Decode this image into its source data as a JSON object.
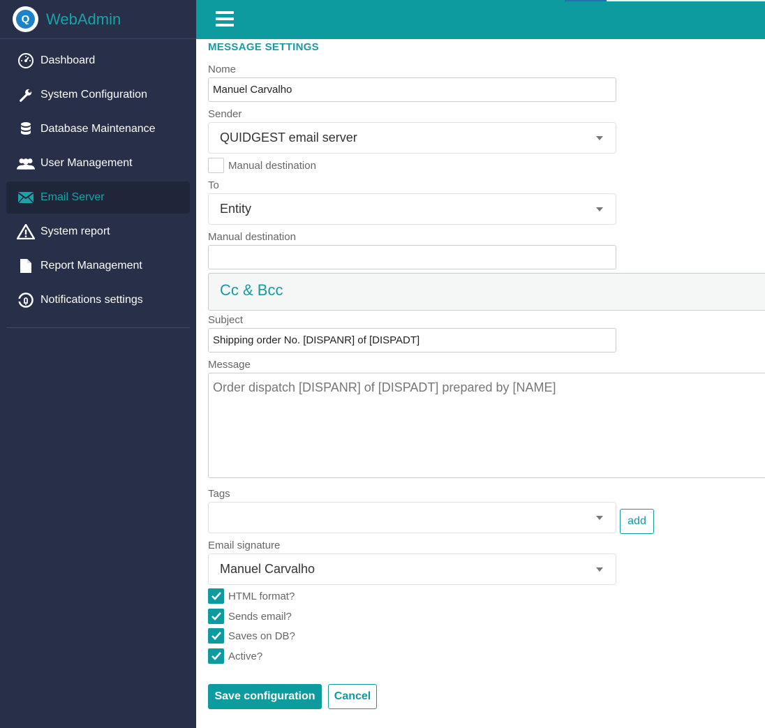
{
  "app": {
    "name": "WebAdmin",
    "logo_letter": "Q"
  },
  "sidebar": {
    "items": [
      {
        "label": "Dashboard",
        "icon": "dashboard-icon"
      },
      {
        "label": "System Configuration",
        "icon": "wrench-icon"
      },
      {
        "label": "Database Maintenance",
        "icon": "database-icon"
      },
      {
        "label": "User Management",
        "icon": "users-icon"
      },
      {
        "label": "Email Server",
        "icon": "envelope-icon",
        "active": true
      },
      {
        "label": "System report",
        "icon": "warning-icon"
      },
      {
        "label": "Report Management",
        "icon": "file-icon"
      },
      {
        "label": "Notifications settings",
        "icon": "notification-icon"
      }
    ]
  },
  "form": {
    "section_title": "MESSAGE SETTINGS",
    "name_label": "Nome",
    "name_value": "Manuel Carvalho",
    "sender_label": "Sender",
    "sender_value": "QUIDGEST email server",
    "manual_destination_check_label": "Manual destination",
    "to_label": "To",
    "to_value": "Entity",
    "manual_destination_label": "Manual destination",
    "manual_destination_value": "",
    "cc_bcc_title": "Cc & Bcc",
    "subject_label": "Subject",
    "subject_value": "Shipping order No. [DISPANR] of [DISPADT]",
    "message_label": "Message",
    "message_value": "Order dispatch [DISPANR] of [DISPADT] prepared by [NAME]",
    "tags_label": "Tags",
    "tags_value": "",
    "add_label": "add",
    "signature_label": "Email signature",
    "signature_value": "Manuel Carvalho",
    "html_format_label": "HTML format?",
    "sends_email_label": "Sends email?",
    "saves_db_label": "Saves on DB?",
    "active_label": "Active?",
    "save_label": "Save configuration",
    "cancel_label": "Cancel"
  },
  "colors": {
    "accent": "#0d9ba0",
    "sidebar_bg": "#272f49",
    "brand": "#1aa2a8"
  }
}
